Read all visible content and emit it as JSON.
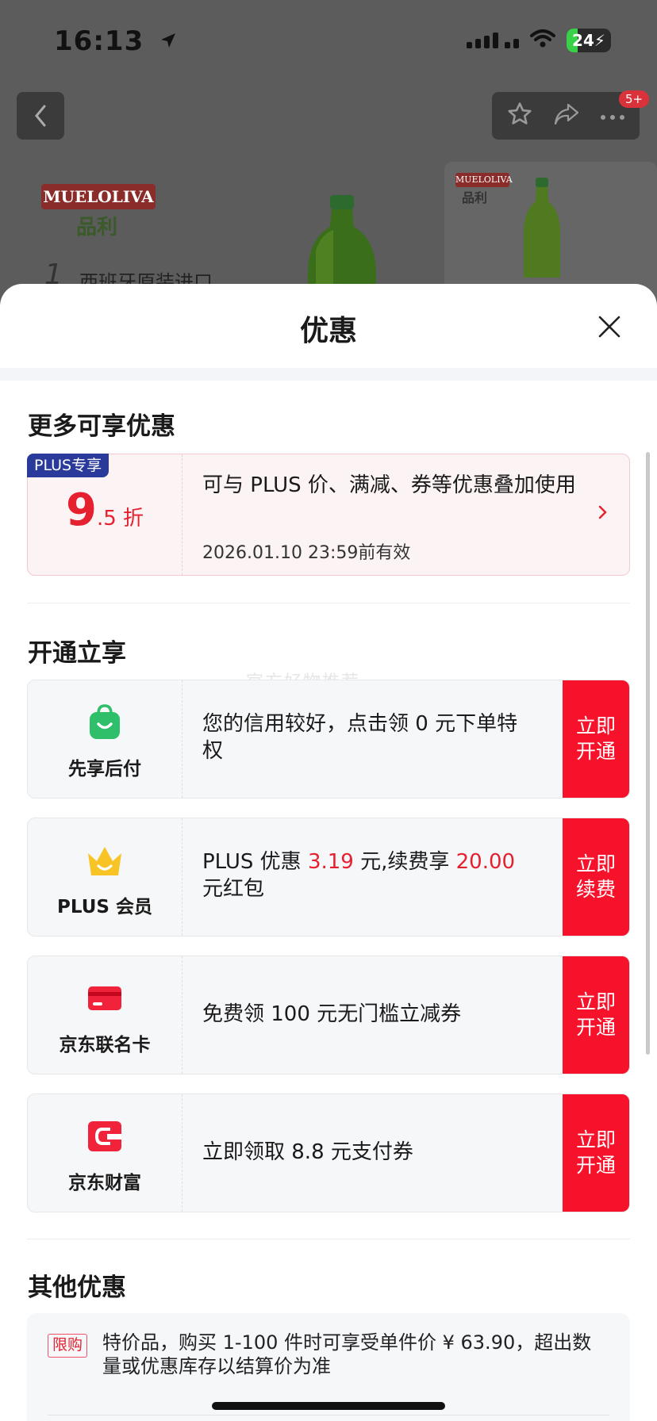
{
  "status_bar": {
    "time": "16:13",
    "battery": "24"
  },
  "nav": {
    "badge": "5+"
  },
  "background": {
    "brand_logo": "MUELOLIVA",
    "brand_cn": "品利",
    "promo_num": "1",
    "promo_line": "西班牙原装进口",
    "thumb_brand": "MUELOLIVA",
    "thumb_cn": "品利"
  },
  "sheet": {
    "title": "优惠",
    "watermark": "官方好物推荐",
    "more_title": "更多可享优惠",
    "plus_card": {
      "tag": "PLUS专享",
      "discount_big": "9",
      "discount_small": ".5 折",
      "desc": "可与 PLUS 价、满减、券等优惠叠加使用",
      "date": "2026.01.10 23:59前有效"
    },
    "open_title": "开通立享",
    "services": [
      {
        "name": "先享后付",
        "text": "您的信用较好，点击领 0 元下单特权",
        "btn_line1": "立即",
        "btn_line2": "开通"
      },
      {
        "name": "PLUS 会员",
        "text_a": "PLUS 优惠 ",
        "red_a": "3.19",
        "text_b": " 元,续费享 ",
        "red_b": "20.00",
        "text_c": " 元红包",
        "btn_line1": "立即",
        "btn_line2": "续费"
      },
      {
        "name": "京东联名卡",
        "text": "免费领 100 元无门槛立减券",
        "btn_line1": "立即",
        "btn_line2": "开通"
      },
      {
        "name": "京东财富",
        "text": "立即领取 8.8 元支付券",
        "btn_line1": "立即",
        "btn_line2": "开通"
      }
    ],
    "other_title": "其他优惠",
    "other": {
      "tag": "限购",
      "text": "特价品，购买 1-100 件时可享受单件价 ¥ 63.90，超出数量或优惠库存以结算价为准"
    }
  },
  "colors": {
    "accent_red": "#e6212f",
    "button_red": "#f5122a",
    "plus_blue": "#2a3a9a",
    "wallet_green": "#2fbf6a",
    "crown_yellow": "#f7c325"
  }
}
